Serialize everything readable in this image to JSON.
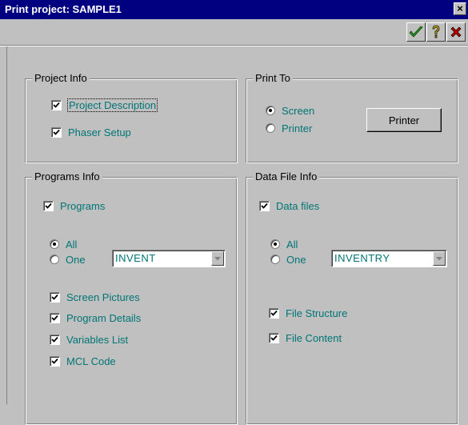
{
  "window": {
    "title": "Print project: SAMPLE1",
    "close_glyph": "×"
  },
  "toolbar": {
    "ok_icon": "check-icon",
    "help_icon": "question-icon",
    "cancel_icon": "x-icon"
  },
  "project_info": {
    "label": "Project Info",
    "items": [
      {
        "label": "Project Description",
        "checked": true
      },
      {
        "label": "Phaser Setup",
        "checked": true
      }
    ]
  },
  "print_to": {
    "label": "Print To",
    "options": [
      {
        "label": "Screen",
        "selected": true
      },
      {
        "label": "Printer",
        "selected": false
      }
    ],
    "printer_button": "Printer"
  },
  "programs_info": {
    "label": "Programs Info",
    "programs_label": "Programs",
    "programs_checked": true,
    "options": [
      {
        "label": "All",
        "selected": true
      },
      {
        "label": "One",
        "selected": false
      }
    ],
    "selected_program": "INVENT",
    "items": [
      {
        "label": "Screen Pictures",
        "checked": true
      },
      {
        "label": "Program Details",
        "checked": true
      },
      {
        "label": "Variables List",
        "checked": true
      },
      {
        "label": "MCL Code",
        "checked": true
      }
    ]
  },
  "data_file_info": {
    "label": "Data File Info",
    "datafiles_label": "Data files",
    "datafiles_checked": true,
    "options": [
      {
        "label": "All",
        "selected": true
      },
      {
        "label": "One",
        "selected": false
      }
    ],
    "selected_file": "INVENTRY",
    "items": [
      {
        "label": "File Structure",
        "checked": true
      },
      {
        "label": "File Content",
        "checked": true
      }
    ]
  },
  "colors": {
    "title_bar": "#000080",
    "face": "#c0c0c0",
    "label_teal": "#007575",
    "ok_green": "#2e8b22",
    "help_yellow": "#e8c800",
    "cancel_red": "#c00000"
  }
}
